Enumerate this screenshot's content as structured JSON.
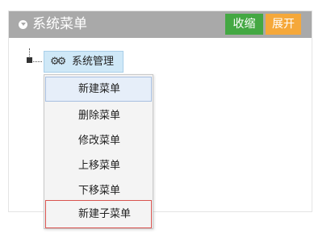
{
  "panel": {
    "title": "系统菜单",
    "collapse_label": "收缩",
    "expand_label": "展开",
    "colors": {
      "header": "#a9a9a9",
      "collapse": "#44a843",
      "expand": "#f5a83a"
    }
  },
  "tree": {
    "root_label": "系统管理",
    "root_icon": "gear-icon"
  },
  "context_menu": {
    "items": [
      {
        "label": "新建菜单"
      },
      {
        "label": "删除菜单"
      },
      {
        "label": "修改菜单"
      },
      {
        "label": "上移菜单"
      },
      {
        "label": "下移菜单"
      },
      {
        "label": "新建子菜单"
      }
    ]
  }
}
